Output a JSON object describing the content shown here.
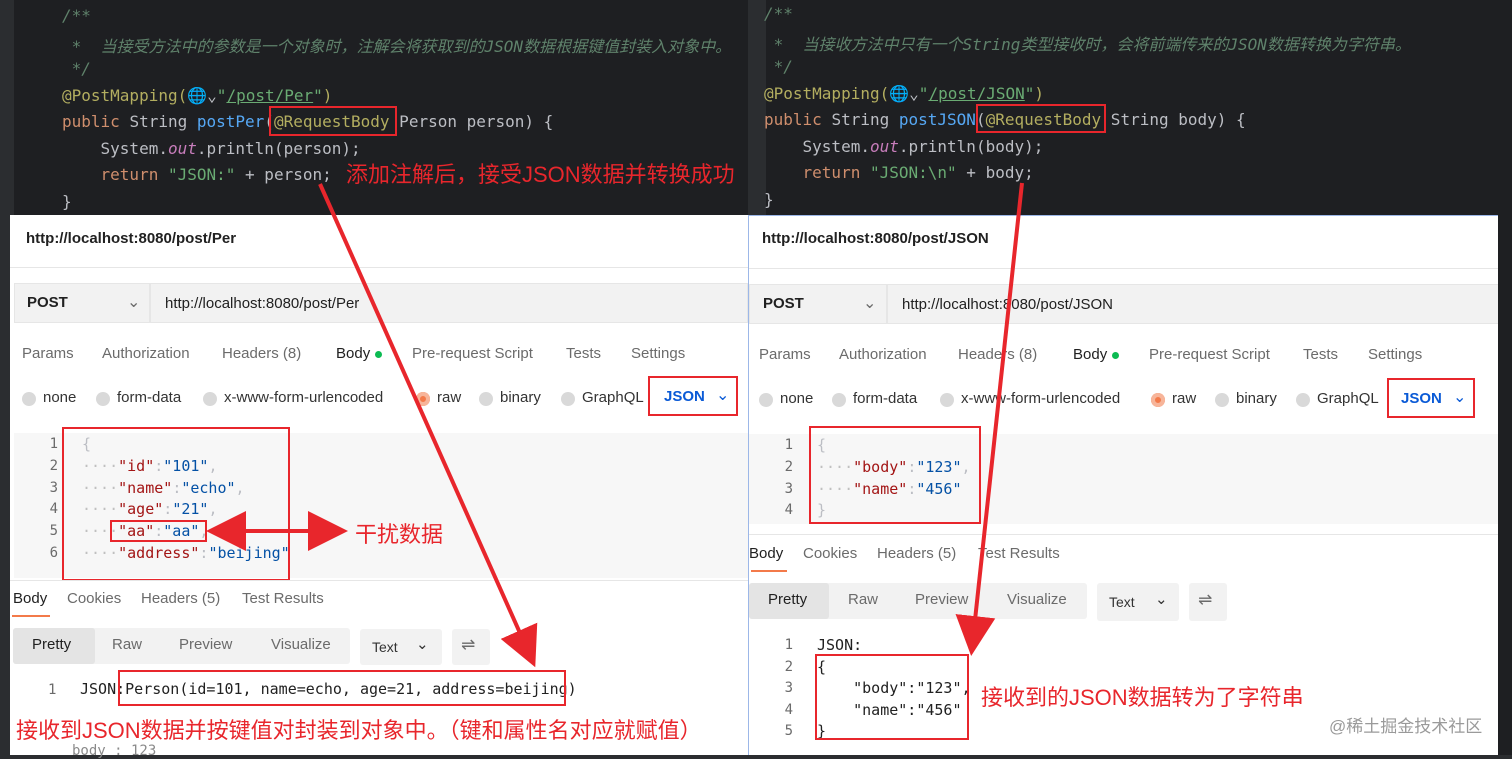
{
  "left_ide": {
    "lines": [
      {
        "parts": [
          [
            "cmt",
            "/**"
          ]
        ]
      },
      {
        "parts": [
          [
            "cmt",
            " *  当接受方法中的参数是一个对象时，注解会将获取到的JSON数据根据键值封装入对象中。"
          ]
        ]
      },
      {
        "parts": [
          [
            "cmt",
            " */"
          ]
        ]
      },
      {
        "parts": [
          [
            "ann",
            "@PostMapping("
          ],
          [
            "pl",
            "🌐⌄"
          ],
          [
            "str",
            "\""
          ],
          [
            "url",
            "/post/Per"
          ],
          [
            "str",
            "\""
          ],
          [
            "ann",
            ")"
          ]
        ]
      },
      {
        "parts": [
          [
            "kw",
            "public "
          ],
          [
            "pl",
            "String "
          ],
          [
            "fn",
            "postPer"
          ],
          [
            "pl",
            "("
          ],
          [
            "ann",
            "@RequestBody"
          ],
          [
            "pl",
            " Person person) {"
          ]
        ]
      },
      {
        "parts": [
          [
            "pl",
            "    System."
          ],
          [
            "fld",
            "out"
          ],
          [
            "pl",
            ".println(person);"
          ]
        ]
      },
      {
        "parts": [
          [
            "pl",
            "    "
          ],
          [
            "kw",
            "return "
          ],
          [
            "str",
            "\"JSON:\""
          ],
          [
            "pl",
            " + person;"
          ]
        ]
      },
      {
        "parts": [
          [
            "pl",
            "}"
          ]
        ]
      }
    ],
    "note": "添加注解后，接受JSON数据并转换成功"
  },
  "right_ide": {
    "lines": [
      {
        "parts": [
          [
            "cmt",
            "/**"
          ]
        ]
      },
      {
        "parts": [
          [
            "cmt",
            " *  当接收方法中只有一个String类型接收时，会将前端传来的JSON数据转换为字符串。"
          ]
        ]
      },
      {
        "parts": [
          [
            "cmt",
            " */"
          ]
        ]
      },
      {
        "parts": [
          [
            "ann",
            "@PostMapping("
          ],
          [
            "pl",
            "🌐⌄"
          ],
          [
            "str",
            "\""
          ],
          [
            "url",
            "/post/JSON"
          ],
          [
            "str",
            "\""
          ],
          [
            "ann",
            ")"
          ]
        ]
      },
      {
        "parts": [
          [
            "kw",
            "public "
          ],
          [
            "pl",
            "String "
          ],
          [
            "fn",
            "postJSON"
          ],
          [
            "pl",
            "("
          ],
          [
            "ann",
            "@RequestBody"
          ],
          [
            "pl",
            " String body) {"
          ]
        ]
      },
      {
        "parts": [
          [
            "pl",
            "    System."
          ],
          [
            "fld",
            "out"
          ],
          [
            "pl",
            ".println(body);"
          ]
        ]
      },
      {
        "parts": [
          [
            "pl",
            "    "
          ],
          [
            "kw",
            "return "
          ],
          [
            "str",
            "\"JSON:\\n\""
          ],
          [
            "pl",
            " + body;"
          ]
        ]
      },
      {
        "parts": [
          [
            "pl",
            "}"
          ]
        ]
      }
    ]
  },
  "left_pm": {
    "title": "http://localhost:8080/post/Per",
    "method": "POST",
    "url": "http://localhost:8080/post/Per",
    "tabs": [
      "Params",
      "Authorization",
      "Headers (8)",
      "Body",
      "Pre-request Script",
      "Tests",
      "Settings"
    ],
    "body_types": [
      "none",
      "form-data",
      "x-www-form-urlencoded",
      "raw",
      "binary",
      "GraphQL"
    ],
    "format": "JSON",
    "req_line_numbers": [
      "1",
      "2",
      "3",
      "4",
      "5",
      "6"
    ],
    "req_lines": [
      [
        [
          "pl",
          "{"
        ]
      ],
      [
        [
          "dots",
          "····"
        ],
        [
          "jk",
          "\"id\""
        ],
        [
          "pl",
          ":"
        ],
        [
          "jv",
          "\"101\""
        ],
        [
          "pl",
          ","
        ]
      ],
      [
        [
          "dots",
          "····"
        ],
        [
          "jk",
          "\"name\""
        ],
        [
          "pl",
          ":"
        ],
        [
          "jv",
          "\"echo\""
        ],
        [
          "pl",
          ","
        ]
      ],
      [
        [
          "dots",
          "····"
        ],
        [
          "jk",
          "\"age\""
        ],
        [
          "pl",
          ":"
        ],
        [
          "jv",
          "\"21\""
        ],
        [
          "pl",
          ","
        ]
      ],
      [
        [
          "dots",
          "····"
        ],
        [
          "jk",
          "\"aa\""
        ],
        [
          "pl",
          ":"
        ],
        [
          "jv",
          "\"aa\""
        ],
        [
          "pl",
          ","
        ]
      ],
      [
        [
          "dots",
          "····"
        ],
        [
          "jk",
          "\"address\""
        ],
        [
          "pl",
          ":"
        ],
        [
          "jv",
          "\"beijing\""
        ]
      ]
    ],
    "resp_tabs": [
      "Body",
      "Cookies",
      "Headers (5)",
      "Test Results"
    ],
    "view_tabs": [
      "Pretty",
      "Raw",
      "Preview",
      "Visualize"
    ],
    "view_format": "Text",
    "resp_line_number": "1",
    "resp_line": "JSON:Person(id=101, name=echo, age=21, address=beijing)",
    "note_interference": "干扰数据",
    "note_bottom": "接收到JSON数据并按键值对封装到对象中。（键和属性名对应就赋值）"
  },
  "right_pm": {
    "title": "http://localhost:8080/post/JSON",
    "method": "POST",
    "url": "http://localhost:8080/post/JSON",
    "tabs": [
      "Params",
      "Authorization",
      "Headers (8)",
      "Body",
      "Pre-request Script",
      "Tests",
      "Settings"
    ],
    "body_types": [
      "none",
      "form-data",
      "x-www-form-urlencoded",
      "raw",
      "binary",
      "GraphQL"
    ],
    "format": "JSON",
    "req_line_numbers": [
      "1",
      "2",
      "3",
      "4"
    ],
    "req_lines": [
      [
        [
          "pl",
          "{"
        ]
      ],
      [
        [
          "dots",
          "····"
        ],
        [
          "jk",
          "\"body\""
        ],
        [
          "pl",
          ":"
        ],
        [
          "jv",
          "\"123\""
        ],
        [
          "pl",
          ","
        ]
      ],
      [
        [
          "dots",
          "····"
        ],
        [
          "jk",
          "\"name\""
        ],
        [
          "pl",
          ":"
        ],
        [
          "jv",
          "\"456\""
        ]
      ],
      [
        [
          "pl",
          "}"
        ]
      ]
    ],
    "resp_tabs": [
      "Body",
      "Cookies",
      "Headers (5)",
      "Test Results"
    ],
    "view_tabs": [
      "Pretty",
      "Raw",
      "Preview",
      "Visualize"
    ],
    "view_format": "Text",
    "resp_line_numbers": [
      "1",
      "2",
      "3",
      "4",
      "5"
    ],
    "resp_lines": [
      "JSON:",
      "{",
      "    \"body\":\"123\",",
      "    \"name\":\"456\"",
      "}"
    ],
    "note": "接收到的JSON数据转为了字符串"
  },
  "watermark": "@稀土掘金技术社区",
  "bottom_fragment": "body : 123",
  "colors": {
    "annotation_red": "#e8262c",
    "postman_blue": "#0a5ad6",
    "postman_orange": "#f37a4a"
  }
}
